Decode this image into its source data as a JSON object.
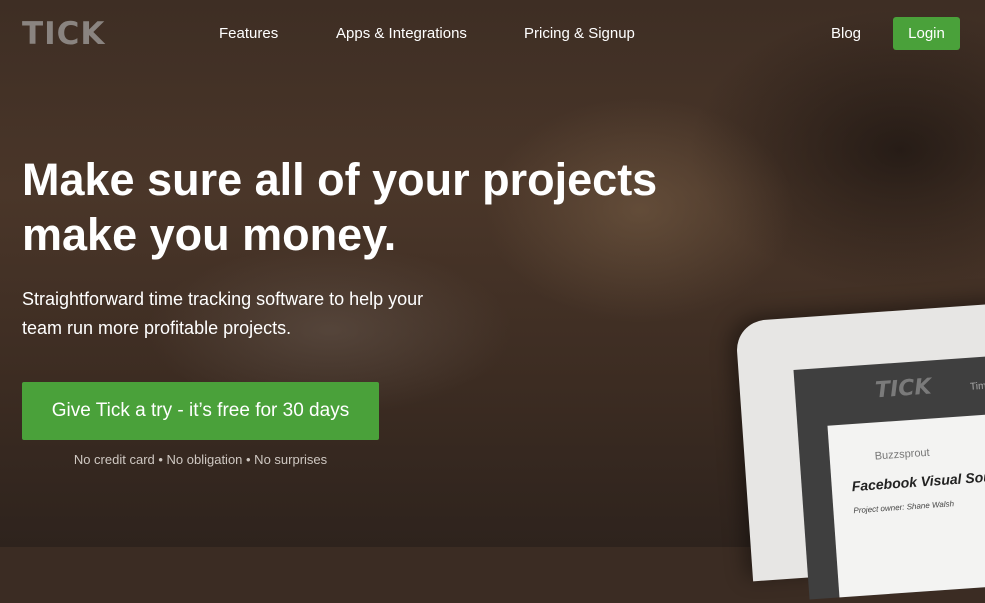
{
  "header": {
    "logo": "TICK",
    "nav": [
      {
        "label": "Features"
      },
      {
        "label": "Apps & Integrations"
      },
      {
        "label": "Pricing & Signup"
      },
      {
        "label": "Blog"
      }
    ],
    "login_label": "Login"
  },
  "hero": {
    "headline": "Make sure all of your projects make you money.",
    "subhead": "Straightforward time tracking software to help your team run more profitable projects.",
    "cta_label": "Give Tick a try - it’s free for 30 days",
    "cta_note": "No credit card • No obligation • No surprises"
  },
  "device_mockup": {
    "logo": "TICK",
    "tab": "Timecard",
    "client": "Buzzsprout",
    "project": "Facebook Visual Soundbite",
    "owner": "Project owner: Shane Walsh"
  },
  "colors": {
    "accent_green": "#4aa13a",
    "background": "#3b2c23"
  }
}
